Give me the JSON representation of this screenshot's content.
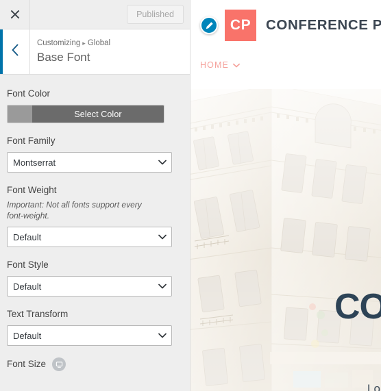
{
  "customizer": {
    "topbar": {
      "close_icon": "close-icon",
      "publish_label": "Published"
    },
    "header": {
      "back_icon": "chevron-left-icon",
      "breadcrumb_root": "Customizing",
      "breadcrumb_separator": "▸",
      "breadcrumb_parent": "Global",
      "title": "Base Font",
      "accent_color": "#0073aa"
    },
    "controls": [
      {
        "name": "font-color",
        "label": "Font Color",
        "type": "color",
        "button_label": "Select Color",
        "swatch_color": "#9a9a9a",
        "button_color": "#6b6b6b"
      },
      {
        "name": "font-family",
        "label": "Font Family",
        "type": "select",
        "value": "Montserrat"
      },
      {
        "name": "font-weight",
        "label": "Font Weight",
        "description": "Important: Not all fonts support every font-weight.",
        "type": "select",
        "value": "Default"
      },
      {
        "name": "font-style",
        "label": "Font Style",
        "type": "select",
        "value": "Default"
      },
      {
        "name": "text-transform",
        "label": "Text Transform",
        "type": "select",
        "value": "Default"
      },
      {
        "name": "font-size",
        "label": "Font Size",
        "type": "responsive",
        "device_icon": "desktop-device-icon"
      }
    ]
  },
  "preview": {
    "edit_shortcut_icon": "pencil-edit-icon",
    "logo_mark": "CP",
    "logo_text": "CONFERENCE PRO",
    "logo_bg_color": "#f9736a",
    "nav": [
      {
        "label": "HOME",
        "has_dropdown": true,
        "color": "#f5a29c"
      }
    ],
    "hero": {
      "title": "CO",
      "subtitle": "Lo",
      "title_color": "#2d4356"
    }
  }
}
